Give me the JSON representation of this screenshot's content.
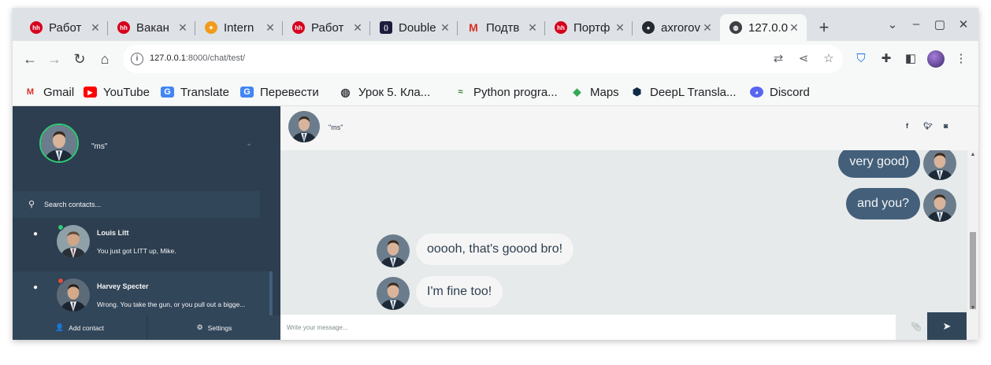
{
  "browser": {
    "tabs": [
      {
        "title": "Работ",
        "icon": "hh-icon"
      },
      {
        "title": "Вакан",
        "icon": "hh-icon"
      },
      {
        "title": "Intern",
        "icon": "chatgpt-icon"
      },
      {
        "title": "Работ",
        "icon": "hh-icon"
      },
      {
        "title": "Double",
        "icon": "double-icon"
      },
      {
        "title": "Подтв",
        "icon": "gmail-icon"
      },
      {
        "title": "Портф",
        "icon": "hh-icon"
      },
      {
        "title": "axrorov",
        "icon": "github-icon"
      },
      {
        "title": "127.0.0",
        "icon": "globe-icon",
        "active": true
      }
    ],
    "url_host": "127.0.0.1",
    "url_rest": ":8000/chat/test/",
    "bookmarks": [
      {
        "label": "Gmail",
        "icon": "gmail-icon"
      },
      {
        "label": "YouTube",
        "icon": "youtube-icon"
      },
      {
        "label": "Translate",
        "icon": "translate-icon"
      },
      {
        "label": "Перевести",
        "icon": "translate-icon"
      },
      {
        "label": "Урок 5. Кла...",
        "icon": "globe-icon"
      },
      {
        "label": "Python progra...",
        "icon": "python-icon"
      },
      {
        "label": "Maps",
        "icon": "maps-icon"
      },
      {
        "label": "DeepL Transla...",
        "icon": "deepl-icon"
      },
      {
        "label": "Discord",
        "icon": "discord-icon"
      }
    ]
  },
  "chat": {
    "me": {
      "name": "\"ms\"",
      "status_color": "#2ecc71"
    },
    "search_placeholder": "Search contacts...",
    "contacts": [
      {
        "name": "Louis Litt",
        "preview": "You just got LITT up, Mike.",
        "status_color": "#2ecc71"
      },
      {
        "name": "Harvey Specter",
        "preview": "Wrong. You take the gun, or you pull out a bigge...",
        "status_color": "#e74c3c",
        "active": true
      }
    ],
    "bottom": {
      "add_contact": "Add contact",
      "settings": "Settings"
    },
    "header": {
      "name": "\"ms\"",
      "social": [
        "facebook-icon",
        "twitter-icon",
        "instagram-icon"
      ]
    },
    "messages": [
      {
        "text": "very good)",
        "type": "sent"
      },
      {
        "text": "and you?",
        "type": "sent"
      },
      {
        "text": "ooooh, that's goood bro!",
        "type": "replied"
      },
      {
        "text": "I'm fine too!",
        "type": "replied"
      }
    ],
    "composer_placeholder": "Write your message..."
  },
  "colors": {
    "sidebar": "#2c3e50",
    "sidebar_active": "#32465a",
    "sent_bubble": "#435f7a",
    "replied_bubble": "#f5f5f5",
    "chat_bg": "#e6eaea"
  }
}
